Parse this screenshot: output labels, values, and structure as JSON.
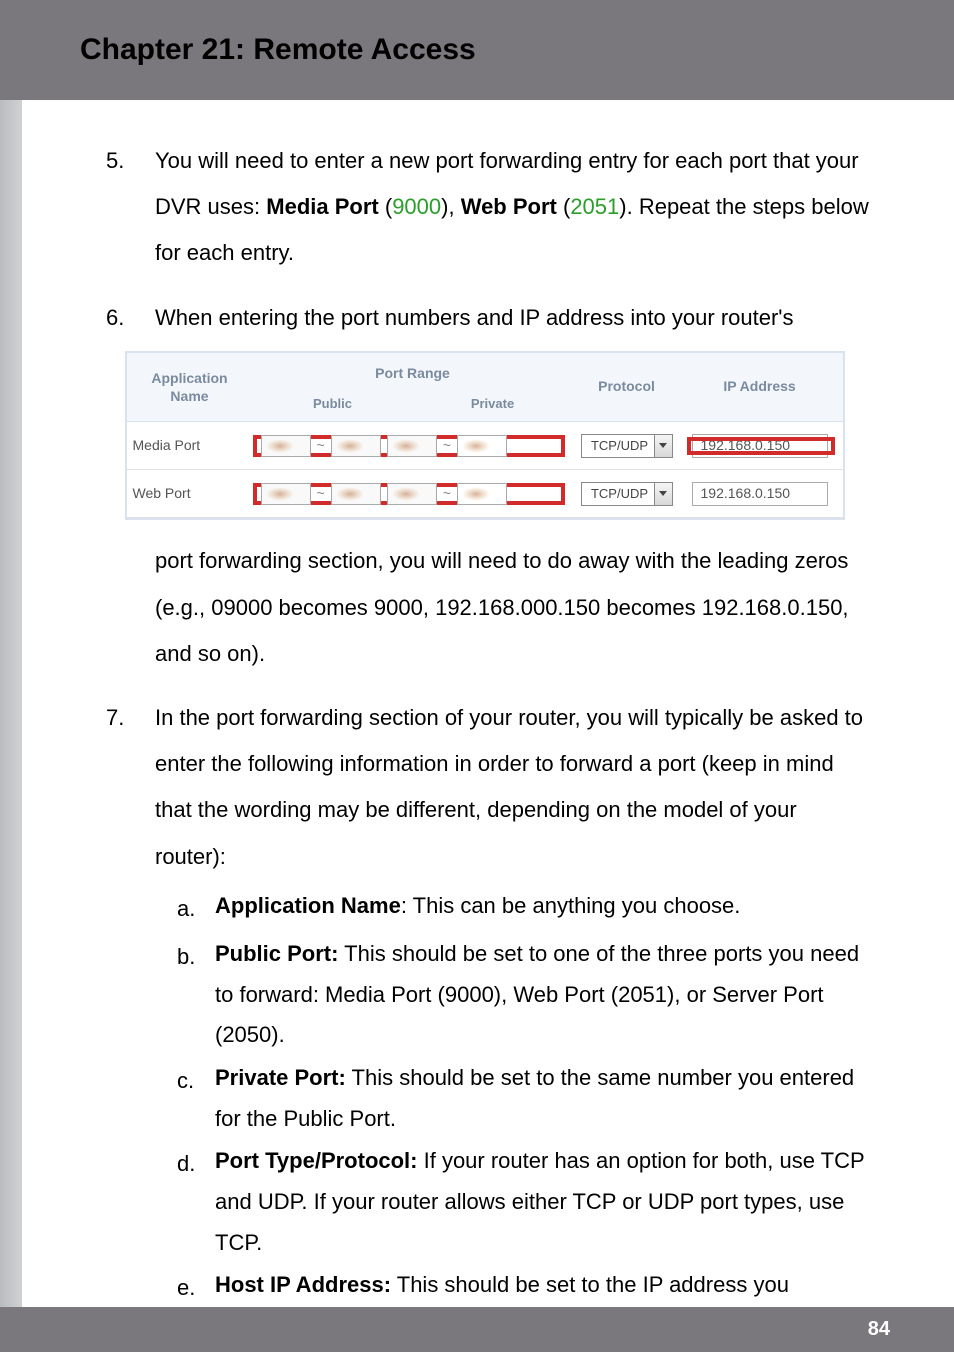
{
  "header": {
    "title": "Chapter 21: Remote Access"
  },
  "list": {
    "item5_num": "5.",
    "item5_text_a": "You will need to enter a new port forwarding entry for each port that your DVR uses: ",
    "item5_media_port_label": "Media Port",
    "item5_media_port_value": "9000",
    "item5_web_port_label": "Web Port",
    "item5_web_port_value": "2051",
    "item5_text_b": ". Repeat the steps below for each entry.",
    "item6_num": "6.",
    "item6_text_a": "When entering the port numbers and IP address into your router's",
    "item6_text_b": "port forwarding section, you will need to do away with the leading zeros (e.g., 09000 becomes 9000, 192.168.000.150 becomes 192.168.0.150, and so on).",
    "item7_num": "7.",
    "item7_text": "In the port forwarding section of your router, you will typically be asked to enter the following information in order to forward a port (keep in mind that the wording may be different, depending on the model of your router):"
  },
  "sub": {
    "a_letter": "a.",
    "a_label": "Application Name",
    "a_text": ": This can be anything you choose.",
    "b_letter": "b.",
    "b_label": "Public Port:",
    "b_text": " This should be set to one of the three ports you need to forward: Media Port (9000), Web Port (2051), or Server Port (2050).",
    "c_letter": "c.",
    "c_label": "Private Port:",
    "c_text": " This should be set to the same number you entered for the Public Port.",
    "d_letter": "d.",
    "d_label": "Port Type/Protocol:",
    "d_text": " If your router has an option for both, use TCP and UDP. If your router allows either TCP or UDP port types, use TCP.",
    "e_letter": "e.",
    "e_label": "Host IP Address:",
    "e_text": " This should be set to the IP address you configured for your DVR earlier."
  },
  "router_table": {
    "header": {
      "appname_l1": "Application",
      "appname_l2": "Name",
      "port_range": "Port Range",
      "public": "Public",
      "private": "Private",
      "protocol": "Protocol",
      "ip": "IP Address"
    },
    "rows": [
      {
        "name": "Media Port",
        "protocol": "TCP/UDP",
        "ip": "192.168.0.150"
      },
      {
        "name": "Web Port",
        "protocol": "TCP/UDP",
        "ip": "192.168.0.150"
      }
    ]
  },
  "footer": {
    "page": "84"
  }
}
